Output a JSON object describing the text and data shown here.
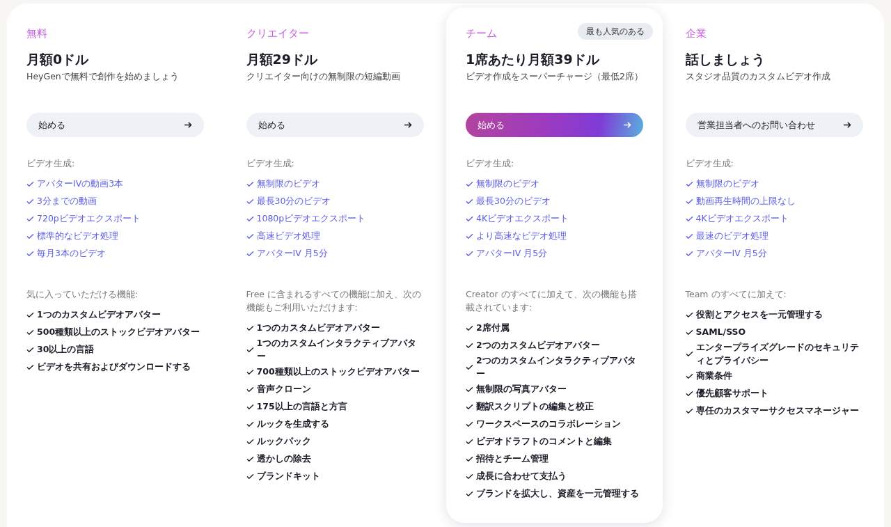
{
  "plans": [
    {
      "name": "無料",
      "price": "月額0ドル",
      "description": "HeyGenで無料で創作を始めましょう",
      "featured": false,
      "button": "始める",
      "video_heading": "ビデオ生成:",
      "video_features": [
        "アバターIVの動画3本",
        "3分までの動画",
        "720pビデオエクスポート",
        "標準的なビデオ処理",
        "毎月3本のビデオ"
      ],
      "features_heading": "気に入っていただける機能:",
      "features": [
        "1つのカスタムビデオアバター",
        "500種類以上のストックビデオアバター",
        "30以上の言語",
        "ビデオを共有およびダウンロードする"
      ]
    },
    {
      "name": "クリエイター",
      "price": "月額29ドル",
      "description": "クリエイター向けの無制限の短編動画",
      "featured": false,
      "button": "始める",
      "video_heading": "ビデオ生成:",
      "video_features": [
        "無制限のビデオ",
        "最長30分のビデオ",
        "1080pビデオエクスポート",
        "高速ビデオ処理",
        "アバターIV 月5分"
      ],
      "features_heading": "Free に含まれるすべての機能に加え、次の機能もご利用いただけます:",
      "features": [
        "1つのカスタムビデオアバター",
        "1つのカスタムインタラクティブアバター",
        "700種類以上のストックビデオアバター",
        "音声クローン",
        "175以上の言語と方言",
        "ルックを生成する",
        "ルックパック",
        "透かしの除去",
        "ブランドキット"
      ]
    },
    {
      "name": "チーム",
      "badge": "最も人気のある",
      "price": "1席あたり月額39ドル",
      "description": "ビデオ作成をスーパーチャージ（最低2席）",
      "featured": true,
      "button": "始める",
      "video_heading": "ビデオ生成:",
      "video_features": [
        "無制限のビデオ",
        "最長30分のビデオ",
        "4Kビデオエクスポート",
        "より高速なビデオ処理",
        "アバターIV 月5分"
      ],
      "features_heading": "Creator のすべてに加えて、次の機能も搭載されています:",
      "features": [
        "2席付属",
        "2つのカスタムビデオアバター",
        "2つのカスタムインタラクティブアバター",
        "無制限の写真アバター",
        "翻訳スクリプトの編集と校正",
        "ワークスペースのコラボレーション",
        "ビデオドラフトのコメントと編集",
        "招待とチーム管理",
        "成長に合わせて支払う",
        "ブランドを拡大し、資産を一元管理する"
      ]
    },
    {
      "name": "企業",
      "price": "話しましょう",
      "description": "スタジオ品質のカスタムビデオ作成",
      "featured": false,
      "button": "営業担当者へのお問い合わせ",
      "video_heading": "ビデオ生成:",
      "video_features": [
        "無制限のビデオ",
        "動画再生時間の上限なし",
        "4Kビデオエクスポート",
        "最速のビデオ処理",
        "アバターIV 月5分"
      ],
      "features_heading": "Team のすべてに加えて:",
      "features": [
        "役割とアクセスを一元管理する",
        "SAML/SSO",
        "エンタープライズグレードのセキュリティとプライバシー",
        "商業条件",
        "優先顧客サポート",
        "専任のカスタマーサクセスマネージャー"
      ]
    }
  ]
}
